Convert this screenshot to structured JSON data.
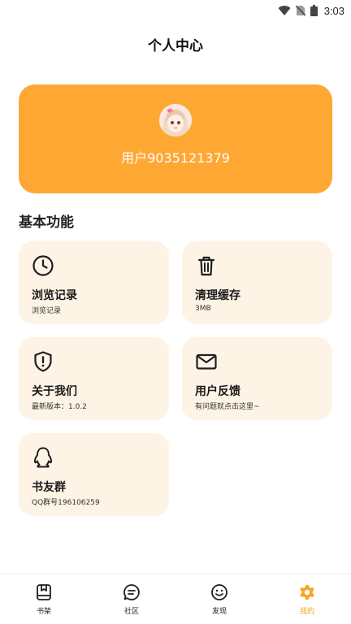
{
  "status_bar": {
    "time": "3:03",
    "icons": [
      "wifi-icon",
      "no-sim-icon",
      "battery-icon"
    ]
  },
  "header": {
    "title": "个人中心"
  },
  "profile": {
    "username": "用户9035121379",
    "card_color": "#FFA733"
  },
  "section": {
    "title": "基本功能"
  },
  "tiles": [
    {
      "icon": "clock-icon",
      "title": "浏览记录",
      "subtitle": "浏览记录"
    },
    {
      "icon": "trash-icon",
      "title": "清理缓存",
      "subtitle": "3MB"
    },
    {
      "icon": "shield-alert-icon",
      "title": "关于我们",
      "subtitle": "最新版本：1.0.2"
    },
    {
      "icon": "mail-icon",
      "title": "用户反馈",
      "subtitle": "有问题就点击这里~"
    },
    {
      "icon": "qq-penguin-icon",
      "title": "书友群",
      "subtitle": "QQ群号196106259"
    }
  ],
  "bottom_nav": {
    "active_index": 3,
    "active_color": "#F5A623",
    "items": [
      {
        "icon": "bookshelf-icon",
        "label": "书架"
      },
      {
        "icon": "chat-icon",
        "label": "社区"
      },
      {
        "icon": "smile-icon",
        "label": "发现"
      },
      {
        "icon": "gear-icon",
        "label": "我的"
      }
    ]
  }
}
